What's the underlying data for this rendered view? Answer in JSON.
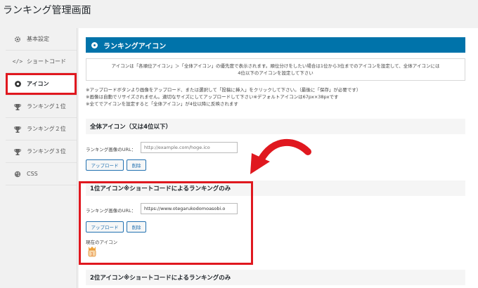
{
  "page": {
    "title": "ランキング管理画面"
  },
  "sidebar": {
    "items": [
      {
        "label": "基本設定",
        "icon": "gear-icon"
      },
      {
        "label": "ショートコード",
        "icon": "code-icon"
      },
      {
        "label": "アイコン",
        "icon": "eye-icon",
        "active": true
      },
      {
        "label": "ランキング１位",
        "icon": "trophy-icon"
      },
      {
        "label": "ランキング２位",
        "icon": "trophy-icon"
      },
      {
        "label": "ランキング３位",
        "icon": "trophy-icon"
      },
      {
        "label": "CSS",
        "icon": "palette-icon"
      }
    ]
  },
  "main": {
    "header": "ランキングアイコン",
    "info": {
      "line1": "アイコンは「各順位アイコン」＞「全体アイコン」の優先度で表示されます。順位分けをしたい場合は1位から3位までのアイコンを設定して、全体アイコンには",
      "line2": "4位以下のアイコンを設定して下さい"
    },
    "notes": [
      "※アップロードボタンより画像をアップロード、または選択して「投稿に挿入」をクリックして下さい。（最後に「保存」が必要です）",
      "※画像は自動でリサイズされません。適切なサイズにしてアップロードして下さい※デフォルトアイコンは67px×38pxです",
      "※全てでアイコンを設定すると「全体アイコン」が4位以降に反映されます"
    ],
    "sections": [
      {
        "title": "全体アイコン（又は4位以下）",
        "url_label": "ランキング画像のURL：",
        "url_value": "",
        "url_placeholder": "http://example.com/hoge.ico",
        "upload": "アップロード",
        "delete": "削除"
      },
      {
        "title": "1位アイコン※ショートコードによるランキングのみ",
        "url_label": "ランキング画像のURL：",
        "url_value": "https://www.otegarukodomoasobi.o",
        "url_placeholder": "",
        "upload": "アップロード",
        "delete": "削除",
        "current_label": "現在のアイコン"
      },
      {
        "title": "2位アイコン※ショートコードによるランキングのみ"
      }
    ]
  },
  "colors": {
    "accent": "#0073aa",
    "highlight": "#e0181f"
  }
}
